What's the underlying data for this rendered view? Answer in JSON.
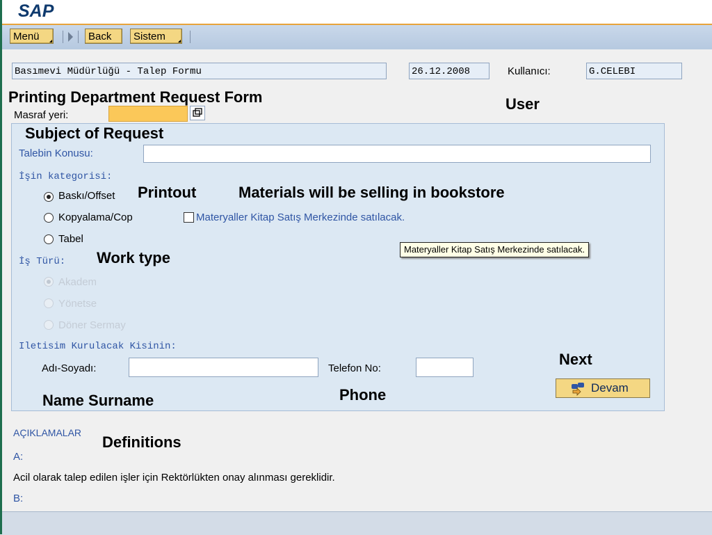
{
  "app": {
    "logo": "SAP"
  },
  "toolbar": {
    "menu": "Menü",
    "back": "Back",
    "sistem": "Sistem"
  },
  "header": {
    "form_title": "Basımevi Müdürlüğü - Talep Formu",
    "date": "26.12.2008",
    "user_label": "Kullanıcı:",
    "user_value": "G.CELEBI"
  },
  "cost_center": {
    "label": "Masraf yeri:",
    "value": ""
  },
  "form": {
    "subject_label": "Talebin Konusu:",
    "subject_value": "",
    "category_heading": "İşin kategorisi:",
    "categories": [
      "Baskı/Offset",
      "Kopyalama/Cop",
      "Tabel"
    ],
    "selected_category": "Baskı/Offset",
    "bookstore_checkbox": "Materyaller Kitap Satış Merkezinde satılacak.",
    "bookstore_checked": false,
    "tooltip": "Materyaller Kitap Satış Merkezinde satılacak.",
    "work_type_heading": "İş Türü:",
    "work_types": [
      "Akadem",
      "Yönetse",
      "Döner Sermay"
    ],
    "contact_heading": "Iletisim Kurulacak Kisinin:",
    "name_label": "Adı-Soyadı:",
    "name_value": "",
    "phone_label": "Telefon No:",
    "phone_value": "",
    "next_button": "Devam"
  },
  "notes": {
    "heading": "AÇIKLAMALAR",
    "a_label": "A:",
    "a_text": "Acil olarak talep edilen işler için Rektörlükten onay alınması gereklidir.",
    "b_label": "B:"
  },
  "annotations": {
    "form_title": "Printing Department Request Form",
    "user": "User",
    "subject": "Subject of Request",
    "printout": "Printout",
    "materials": "Materials will be selling in bookstore",
    "work_type": "Work type",
    "next": "Next",
    "phone": "Phone",
    "name": "Name Surname",
    "definitions": "Definitions"
  },
  "colors": {
    "accent_orange": "#e8a33a",
    "panel_blue": "#dce8f3",
    "label_blue": "#2f55a4",
    "button_yellow": "#f4d783"
  }
}
